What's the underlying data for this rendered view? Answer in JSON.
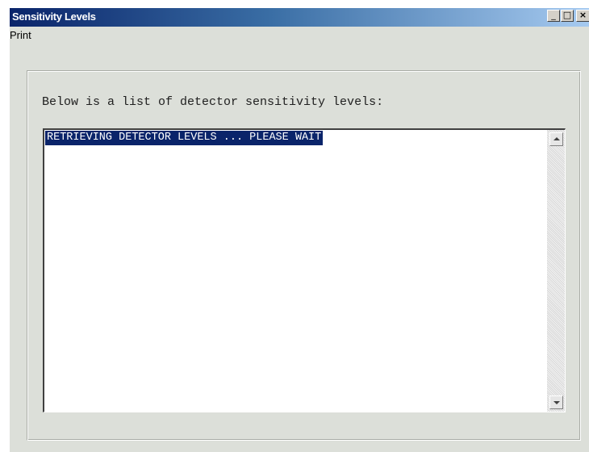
{
  "window": {
    "title": "Sensitivity Levels",
    "controls": {
      "minimize": "_",
      "maximize": "□",
      "close": "×"
    }
  },
  "menu": {
    "items": [
      "Print"
    ]
  },
  "main": {
    "prompt": "Below is a list of detector sensitivity levels:",
    "list": {
      "items": [
        "RETRIEVING DETECTOR LEVELS ... PLEASE WAIT"
      ],
      "selected_index": 0
    }
  },
  "colors": {
    "title_gradient_start": "#0a246a",
    "selection_bg": "#0a246a",
    "window_bg": "#dcdfd9"
  }
}
